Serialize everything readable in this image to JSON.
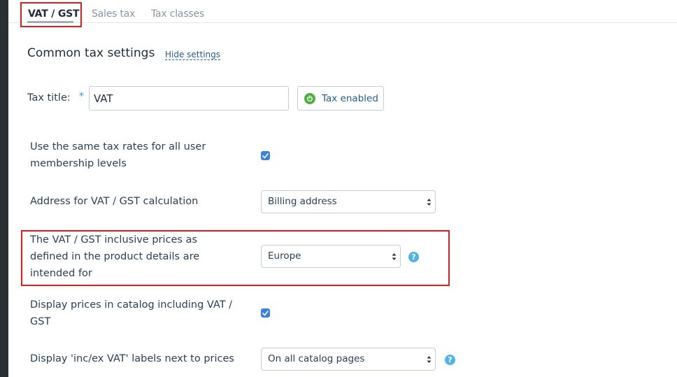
{
  "tabs": [
    {
      "label": "VAT / GST",
      "active": true
    },
    {
      "label": "Sales tax",
      "active": false
    },
    {
      "label": "Tax classes",
      "active": false
    }
  ],
  "section": {
    "title": "Common tax settings",
    "hide_link": "Hide settings"
  },
  "tax_title": {
    "label": "Tax title:",
    "required_mark": "*",
    "value": "VAT",
    "toggle_label": "Tax enabled"
  },
  "settings": {
    "same_rates_line1": "Use the same tax rates for all user",
    "same_rates_line2": "membership levels",
    "same_rates_checked": true,
    "address_label": "Address for VAT / GST calculation",
    "address_value": "Billing address",
    "inclusive_line1": "The VAT / GST inclusive prices as",
    "inclusive_line2": "defined in the product details are",
    "inclusive_line3": "intended for",
    "inclusive_value": "Europe",
    "display_incl_line1": "Display prices in catalog including VAT /",
    "display_incl_line2": "GST",
    "display_incl_checked": true,
    "labels_label": "Display 'inc/ex VAT' labels next to prices",
    "labels_value": "On all catalog pages"
  },
  "colors": {
    "highlight": "#e31b1b",
    "checkbox": "#3b82e0",
    "help_icon": "#4fb3e8",
    "power_icon": "#4caf3c",
    "link": "#1f5e8c"
  }
}
